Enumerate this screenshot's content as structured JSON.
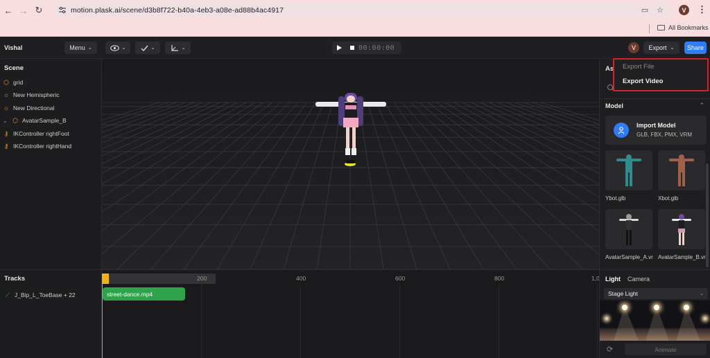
{
  "browser": {
    "url": "motion.plask.ai/scene/d3b8f722-b40a-4eb3-a08e-ad88b4ac4917",
    "profile_initial": "V",
    "bookmarks_label": "All Bookmarks"
  },
  "toolbar": {
    "project_name": "Vishal",
    "menu_label": "Menu",
    "timecode": "00:00:00",
    "avatar_initial": "V",
    "export_label": "Export",
    "share_label": "Share"
  },
  "scene": {
    "title": "Scene",
    "items": [
      {
        "label": "grid",
        "icon": "cube-icon"
      },
      {
        "label": "New Hemispheric",
        "icon": "sun-icon"
      },
      {
        "label": "New Directional",
        "icon": "sun-icon"
      },
      {
        "label": "AvatarSample_B",
        "icon": "cube-icon"
      },
      {
        "label": "IKController rightFoot",
        "icon": "key-icon"
      },
      {
        "label": "IKController rightHand",
        "icon": "key-icon"
      }
    ]
  },
  "assets": {
    "title_partial": "Asa",
    "model_section": "Model",
    "import_title": "Import Model",
    "import_formats": "GLB, FBX, PMX, VRM",
    "thumbs": [
      {
        "label": "Ybot.glb",
        "color": "#2e8c8c"
      },
      {
        "label": "Xbot.glb",
        "color": "#a0614a"
      },
      {
        "label": "AvatarSample_A.vr",
        "color": "#d8d8d8"
      },
      {
        "label": "AvatarSample_B.vr",
        "color": "#d39ab8"
      }
    ]
  },
  "export_menu": {
    "items": [
      "Export File",
      "Export Video"
    ]
  },
  "tracks": {
    "title": "Tracks",
    "item_label": "J_Bip_L_ToeBase + 22",
    "clip_label": "street-dance.mp4",
    "ruler_labels": [
      "200",
      "400",
      "600",
      "800",
      "1,0"
    ]
  },
  "light": {
    "tab_light": "Light",
    "tab_camera": "Camera",
    "selected_preset": "Stage Light",
    "animate_label": "Animate"
  },
  "colors": {
    "accent_blue": "#2f7cf6",
    "clip_green": "#2fa34a",
    "highlight_red": "#d2232a",
    "playhead_yellow": "#f3b315"
  }
}
